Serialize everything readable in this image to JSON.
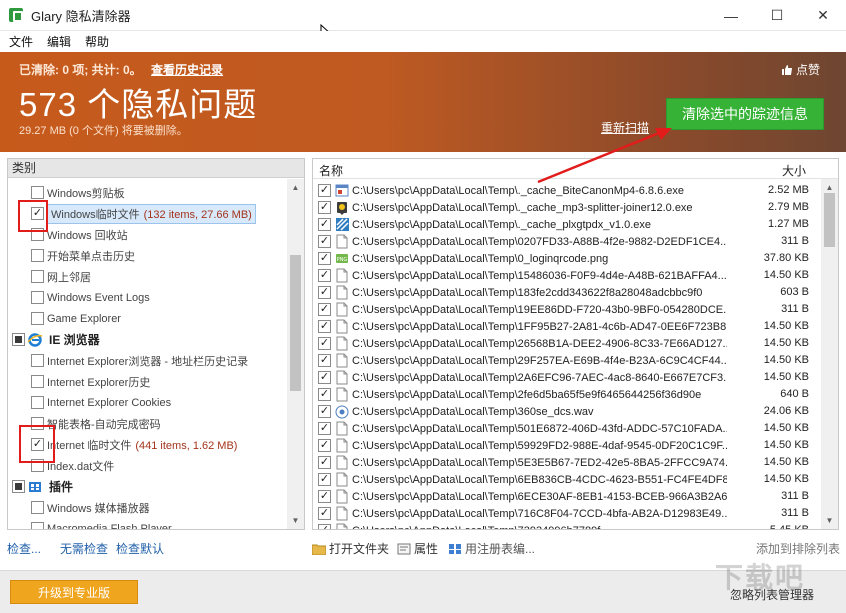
{
  "window": {
    "title": "Glary 隐私清除器",
    "minimize": "—",
    "maximize": "☐",
    "close": "✕"
  },
  "menu": [
    "文件",
    "编辑",
    "帮助"
  ],
  "banner": {
    "stats": "已清除: 0 项; 共计: 0。",
    "history_link": "查看历史记录",
    "big_count": "573 个隐私问题",
    "size_line": "29.27 MB (0 个文件) 将要被删除。",
    "like": "点赞",
    "rescan": "重新扫描",
    "clean_button": "清除选中的踪迹信息"
  },
  "categories": {
    "header": "类别",
    "items": [
      {
        "label": "Windows剪贴板",
        "checked": false,
        "type": "sub"
      },
      {
        "label": "Windows临时文件",
        "count": "(132 items, 27.66 MB)",
        "checked": true,
        "type": "sub",
        "selected": true
      },
      {
        "label": "Windows 回收站",
        "checked": false,
        "type": "sub"
      },
      {
        "label": "开始菜单点击历史",
        "checked": false,
        "type": "sub"
      },
      {
        "label": "网上邻居",
        "checked": false,
        "type": "sub"
      },
      {
        "label": "Windows Event Logs",
        "checked": false,
        "type": "sub"
      },
      {
        "label": "Game Explorer",
        "checked": false,
        "type": "sub"
      },
      {
        "label": "IE 浏览器",
        "type": "group",
        "icon": "ie-icon"
      },
      {
        "label": "Internet Explorer浏览器 - 地址栏历史记录",
        "checked": false,
        "type": "sub"
      },
      {
        "label": "Internet Explorer历史",
        "checked": false,
        "type": "sub"
      },
      {
        "label": "Internet Explorer Cookies",
        "checked": false,
        "type": "sub"
      },
      {
        "label": "智能表格-自动完成密码",
        "checked": false,
        "type": "sub"
      },
      {
        "label": "Internet 临时文件",
        "count": "(441 items, 1.62 MB)",
        "checked": true,
        "type": "sub"
      },
      {
        "label": "Index.dat文件",
        "checked": false,
        "type": "sub"
      },
      {
        "label": "插件",
        "type": "group",
        "icon": "plugin-icon"
      },
      {
        "label": "Windows 媒体播放器",
        "checked": false,
        "type": "sub"
      },
      {
        "label": "Macromedia Flash Player",
        "checked": false,
        "type": "sub"
      }
    ]
  },
  "files": {
    "col_name": "名称",
    "col_size": "大小",
    "rows": [
      {
        "path": "C:\\Users\\pc\\AppData\\Local\\Temp\\._cache_BiteCanonMp4-6.8.6.exe",
        "size": "2.52 MB",
        "icon": "exe"
      },
      {
        "path": "C:\\Users\\pc\\AppData\\Local\\Temp\\._cache_mp3-splitter-joiner12.0.exe",
        "size": "2.79 MB",
        "icon": "exe2"
      },
      {
        "path": "C:\\Users\\pc\\AppData\\Local\\Temp\\._cache_plxgtpdx_v1.0.exe",
        "size": "1.27 MB",
        "icon": "exe3"
      },
      {
        "path": "C:\\Users\\pc\\AppData\\Local\\Temp\\0207FD33-A88B-4f2e-9882-D2EDF1CE4...",
        "size": "311 B",
        "icon": "file"
      },
      {
        "path": "C:\\Users\\pc\\AppData\\Local\\Temp\\0_loginqrcode.png",
        "size": "37.80 KB",
        "icon": "png"
      },
      {
        "path": "C:\\Users\\pc\\AppData\\Local\\Temp\\15486036-F0F9-4d4e-A48B-621BAFFA4...",
        "size": "14.50 KB",
        "icon": "file"
      },
      {
        "path": "C:\\Users\\pc\\AppData\\Local\\Temp\\183fe2cdd343622f8a28048adcbbc9f0",
        "size": "603 B",
        "icon": "file"
      },
      {
        "path": "C:\\Users\\pc\\AppData\\Local\\Temp\\19EE86DD-F720-43b0-9BF0-054280DCE...",
        "size": "311 B",
        "icon": "file"
      },
      {
        "path": "C:\\Users\\pc\\AppData\\Local\\Temp\\1FF95B27-2A81-4c6b-AD47-0EE6F723B8...",
        "size": "14.50 KB",
        "icon": "file"
      },
      {
        "path": "C:\\Users\\pc\\AppData\\Local\\Temp\\26568B1A-DEE2-4906-8C33-7E66AD127...",
        "size": "14.50 KB",
        "icon": "file"
      },
      {
        "path": "C:\\Users\\pc\\AppData\\Local\\Temp\\29F257EA-E69B-4f4e-B23A-6C9C4CF44...",
        "size": "14.50 KB",
        "icon": "file"
      },
      {
        "path": "C:\\Users\\pc\\AppData\\Local\\Temp\\2A6EFC96-7AEC-4ac8-8640-E667E7CF3...",
        "size": "14.50 KB",
        "icon": "file"
      },
      {
        "path": "C:\\Users\\pc\\AppData\\Local\\Temp\\2fe6d5ba65f5e9f6465644256f36d90e",
        "size": "640 B",
        "icon": "file"
      },
      {
        "path": "C:\\Users\\pc\\AppData\\Local\\Temp\\360se_dcs.wav",
        "size": "24.06 KB",
        "icon": "wav"
      },
      {
        "path": "C:\\Users\\pc\\AppData\\Local\\Temp\\501E6872-406D-43fd-ADDC-57C10FADA...",
        "size": "14.50 KB",
        "icon": "file"
      },
      {
        "path": "C:\\Users\\pc\\AppData\\Local\\Temp\\59929FD2-988E-4daf-9545-0DF20C1C9F...",
        "size": "14.50 KB",
        "icon": "file"
      },
      {
        "path": "C:\\Users\\pc\\AppData\\Local\\Temp\\5E3E5B67-7ED2-42e5-8BA5-2FFCC9A74...",
        "size": "14.50 KB",
        "icon": "file"
      },
      {
        "path": "C:\\Users\\pc\\AppData\\Local\\Temp\\6EB836CB-4CDC-4623-B551-FC4FE4DF8...",
        "size": "14.50 KB",
        "icon": "file"
      },
      {
        "path": "C:\\Users\\pc\\AppData\\Local\\Temp\\6ECE30AF-8EB1-4153-BCEB-966A3B2A6...",
        "size": "311 B",
        "icon": "file"
      },
      {
        "path": "C:\\Users\\pc\\AppData\\Local\\Temp\\716C8F04-7CCD-4bfa-AB2A-D12983E49...",
        "size": "311 B",
        "icon": "file"
      },
      {
        "path": "C:\\Users\\pc\\AppData\\Local\\Temp\\73934996b7789f...",
        "size": "5.45 KB",
        "icon": "file"
      }
    ]
  },
  "bottom": {
    "check": "检查...",
    "no_check": "无需检查",
    "check_default": "检查默认",
    "open_folder": "打开文件夹",
    "properties": "属性",
    "registry": "用注册表编...",
    "add_exclude": "添加到排除列表",
    "upgrade": "升级到专业版",
    "ignore_manager": "忽略列表管理器"
  },
  "watermark": "下载吧",
  "colors": {
    "accent_green": "#36b336",
    "banner_orange": "#c65a1b",
    "highlight_red": "#e21b1b"
  }
}
